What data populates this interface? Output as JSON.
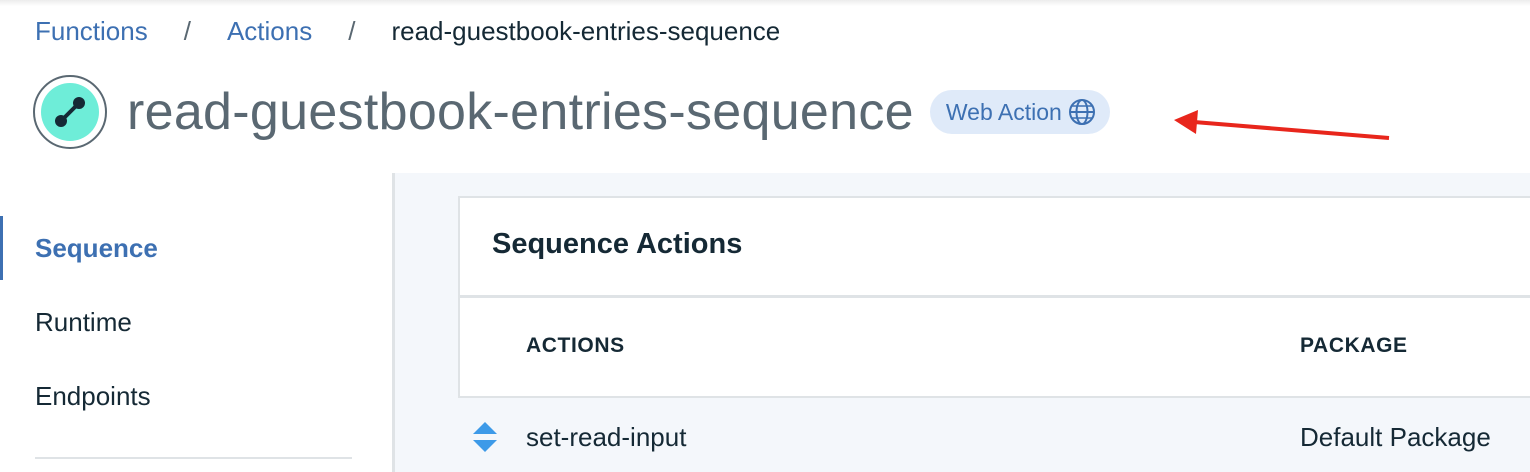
{
  "breadcrumb": {
    "items": [
      "Functions",
      "Actions"
    ],
    "separator": "/",
    "current": "read-guestbook-entries-sequence"
  },
  "header": {
    "title": "read-guestbook-entries-sequence",
    "icon": "sequence-icon",
    "badge": {
      "label": "Web Action",
      "icon": "globe-icon"
    }
  },
  "sidebar": {
    "items": [
      {
        "label": "Sequence",
        "active": true
      },
      {
        "label": "Runtime",
        "active": false
      },
      {
        "label": "Endpoints",
        "active": false
      }
    ]
  },
  "card": {
    "title": "Sequence Actions",
    "columns": [
      "ACTIONS",
      "PACKAGE"
    ],
    "rows": [
      {
        "action": "set-read-input",
        "package": "Default Package"
      }
    ]
  },
  "colors": {
    "link": "#3d70b2",
    "badge_bg": "#dfeaf9",
    "icon_accent": "#6eedd8",
    "annotation": "#e8261c"
  }
}
